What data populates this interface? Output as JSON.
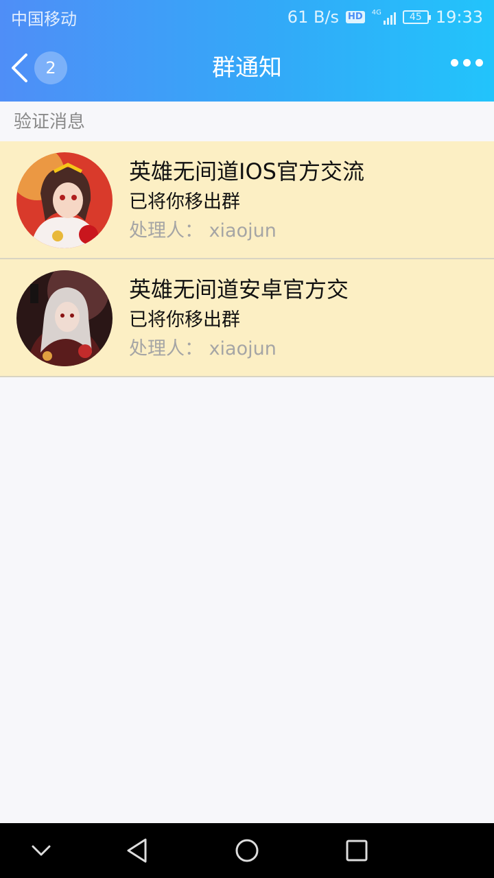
{
  "status_bar": {
    "carrier": "中国移动",
    "speed": "61 B/s",
    "hd": "HD",
    "network": "4G",
    "battery": "45",
    "time": "19:33"
  },
  "header": {
    "title": "群通知",
    "back_count": "2",
    "gradient_start": "#4f8ef7",
    "gradient_end": "#22c4fb"
  },
  "section": {
    "label": "验证消息"
  },
  "notifications": [
    {
      "group_name": "英雄无间道IOS官方交流",
      "message": "已将你移出群",
      "handler": "处理人：  xiaojun"
    },
    {
      "group_name": "英雄无间道安卓官方交",
      "message": "已将你移出群",
      "handler": "处理人：  xiaojun"
    }
  ],
  "colors": {
    "item_background": "#fcefc4",
    "page_background": "#f7f7fa",
    "secondary_text": "#a5a5a5"
  },
  "icons": {
    "back": "chevron-left-icon",
    "more": "more-dots-icon",
    "nav_collapse": "chevron-down-icon",
    "nav_back": "triangle-back-icon",
    "nav_home": "circle-home-icon",
    "nav_recents": "square-recents-icon"
  }
}
